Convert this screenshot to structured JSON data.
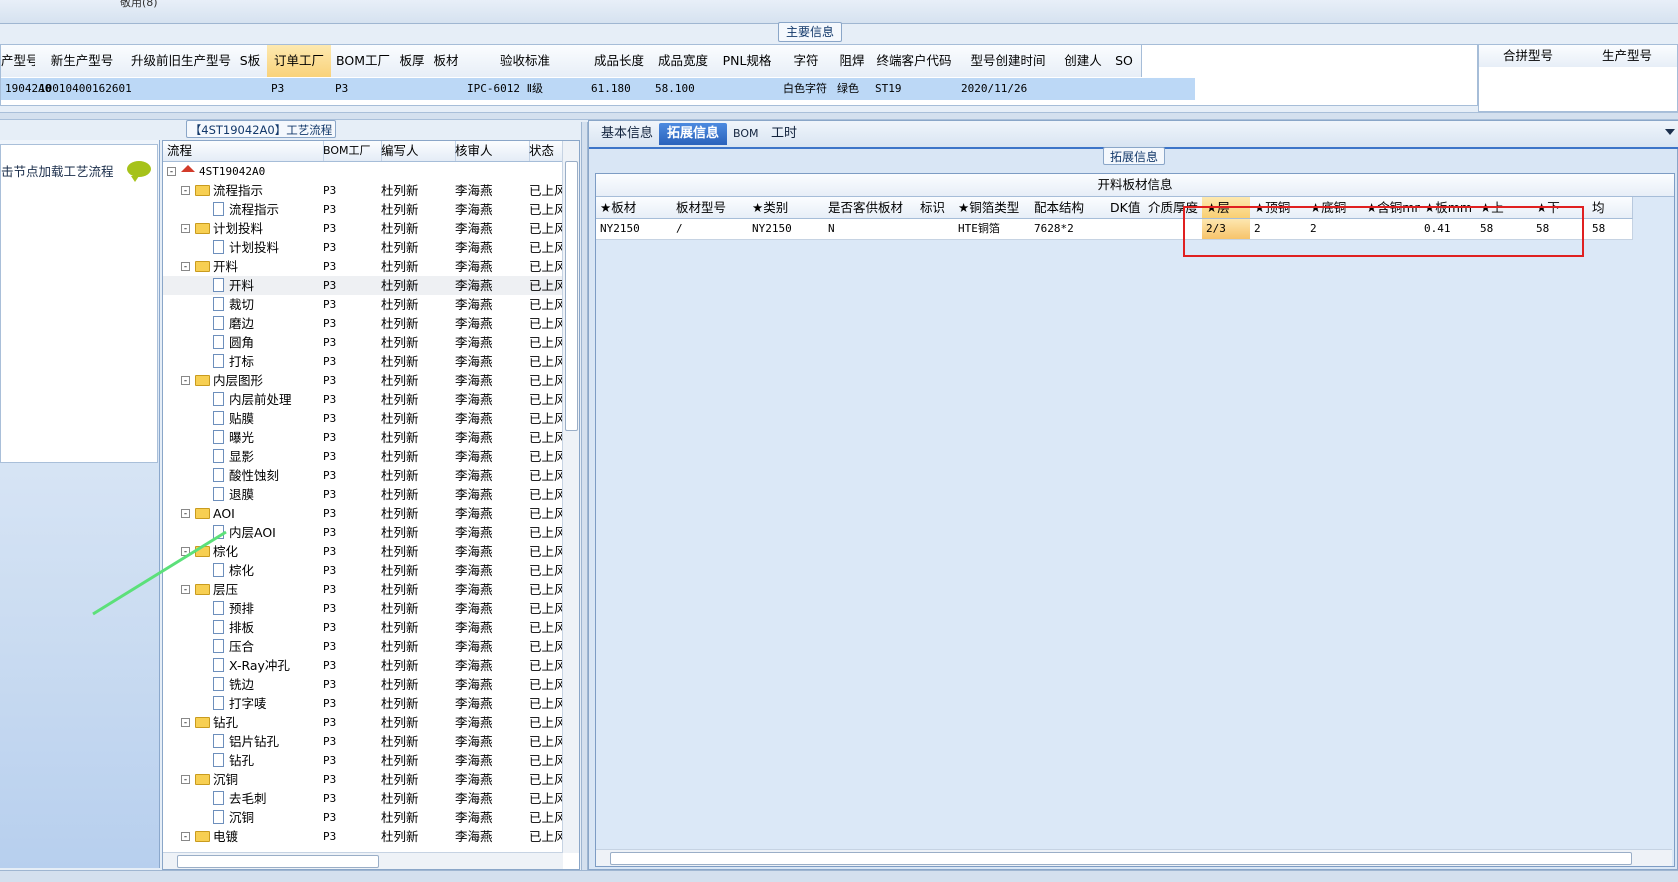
{
  "topbar": {
    "partial_text": "敬用(8)"
  },
  "main_info": {
    "title": "主要信息",
    "columns": [
      "产型号",
      "新生产型号",
      "升级前旧生产型号",
      "S板",
      "订单工厂",
      "BOM工厂",
      "板厚",
      "板材",
      "验收标准",
      "成品长度",
      "成品宽度",
      "PNL规格",
      "字符",
      "阻焊",
      "终端客户代码",
      "型号创建时间",
      "创建人",
      "SO"
    ],
    "row": [
      "19042A0",
      "10010400162601",
      "",
      "",
      "P3",
      "P3",
      "",
      "",
      "IPC-6012 Ⅱ级",
      "61.180",
      "58.100",
      "",
      "白色字符",
      "绿色",
      "ST19",
      "2020/11/26",
      "",
      ""
    ]
  },
  "right_info": {
    "columns": [
      "合拼型号",
      "生产型号"
    ]
  },
  "process": {
    "title": "【4ST19042A0】工艺流程",
    "hint": "击节点加载工艺流程",
    "columns": [
      "流程",
      "BOM工厂",
      "编写人",
      "核审人",
      "状态"
    ],
    "rows": [
      {
        "name": "4ST19042A0",
        "level": 0,
        "type": "root",
        "bom": "",
        "writer": "",
        "reviewer": "",
        "status": ""
      },
      {
        "name": "流程指示",
        "level": 1,
        "type": "folder",
        "bom": "P3",
        "writer": "杜列新",
        "reviewer": "李海燕",
        "status": "已上风"
      },
      {
        "name": "流程指示",
        "level": 2,
        "type": "doc",
        "bom": "P3",
        "writer": "杜列新",
        "reviewer": "李海燕",
        "status": "已上风"
      },
      {
        "name": "计划投料",
        "level": 1,
        "type": "folder",
        "bom": "P3",
        "writer": "杜列新",
        "reviewer": "李海燕",
        "status": "已上风"
      },
      {
        "name": "计划投料",
        "level": 2,
        "type": "doc",
        "bom": "P3",
        "writer": "杜列新",
        "reviewer": "李海燕",
        "status": "已上风"
      },
      {
        "name": "开料",
        "level": 1,
        "type": "folder",
        "bom": "P3",
        "writer": "杜列新",
        "reviewer": "李海燕",
        "status": "已上风"
      },
      {
        "name": "开料",
        "level": 2,
        "type": "doc",
        "bom": "P3",
        "writer": "杜列新",
        "reviewer": "李海燕",
        "status": "已上风",
        "selected": true
      },
      {
        "name": "裁切",
        "level": 2,
        "type": "doc",
        "bom": "P3",
        "writer": "杜列新",
        "reviewer": "李海燕",
        "status": "已上风"
      },
      {
        "name": "磨边",
        "level": 2,
        "type": "doc",
        "bom": "P3",
        "writer": "杜列新",
        "reviewer": "李海燕",
        "status": "已上风"
      },
      {
        "name": "圆角",
        "level": 2,
        "type": "doc",
        "bom": "P3",
        "writer": "杜列新",
        "reviewer": "李海燕",
        "status": "已上风"
      },
      {
        "name": "打标",
        "level": 2,
        "type": "doc",
        "bom": "P3",
        "writer": "杜列新",
        "reviewer": "李海燕",
        "status": "已上风"
      },
      {
        "name": "内层图形",
        "level": 1,
        "type": "folder",
        "bom": "P3",
        "writer": "杜列新",
        "reviewer": "李海燕",
        "status": "已上风"
      },
      {
        "name": "内层前处理",
        "level": 2,
        "type": "doc",
        "bom": "P3",
        "writer": "杜列新",
        "reviewer": "李海燕",
        "status": "已上风"
      },
      {
        "name": "贴膜",
        "level": 2,
        "type": "doc",
        "bom": "P3",
        "writer": "杜列新",
        "reviewer": "李海燕",
        "status": "已上风"
      },
      {
        "name": "曝光",
        "level": 2,
        "type": "doc",
        "bom": "P3",
        "writer": "杜列新",
        "reviewer": "李海燕",
        "status": "已上风"
      },
      {
        "name": "显影",
        "level": 2,
        "type": "doc",
        "bom": "P3",
        "writer": "杜列新",
        "reviewer": "李海燕",
        "status": "已上风"
      },
      {
        "name": "酸性蚀刻",
        "level": 2,
        "type": "doc",
        "bom": "P3",
        "writer": "杜列新",
        "reviewer": "李海燕",
        "status": "已上风"
      },
      {
        "name": "退膜",
        "level": 2,
        "type": "doc",
        "bom": "P3",
        "writer": "杜列新",
        "reviewer": "李海燕",
        "status": "已上风"
      },
      {
        "name": "AOI",
        "level": 1,
        "type": "folder",
        "bom": "P3",
        "writer": "杜列新",
        "reviewer": "李海燕",
        "status": "已上风"
      },
      {
        "name": "内层AOI",
        "level": 2,
        "type": "doc",
        "bom": "P3",
        "writer": "杜列新",
        "reviewer": "李海燕",
        "status": "已上风"
      },
      {
        "name": "棕化",
        "level": 1,
        "type": "folder",
        "bom": "P3",
        "writer": "杜列新",
        "reviewer": "李海燕",
        "status": "已上风"
      },
      {
        "name": "棕化",
        "level": 2,
        "type": "doc",
        "bom": "P3",
        "writer": "杜列新",
        "reviewer": "李海燕",
        "status": "已上风"
      },
      {
        "name": "层压",
        "level": 1,
        "type": "folder",
        "bom": "P3",
        "writer": "杜列新",
        "reviewer": "李海燕",
        "status": "已上风"
      },
      {
        "name": "预排",
        "level": 2,
        "type": "doc",
        "bom": "P3",
        "writer": "杜列新",
        "reviewer": "李海燕",
        "status": "已上风"
      },
      {
        "name": "排板",
        "level": 2,
        "type": "doc",
        "bom": "P3",
        "writer": "杜列新",
        "reviewer": "李海燕",
        "status": "已上风"
      },
      {
        "name": "压合",
        "level": 2,
        "type": "doc",
        "bom": "P3",
        "writer": "杜列新",
        "reviewer": "李海燕",
        "status": "已上风"
      },
      {
        "name": "X-Ray冲孔",
        "level": 2,
        "type": "doc",
        "bom": "P3",
        "writer": "杜列新",
        "reviewer": "李海燕",
        "status": "已上风"
      },
      {
        "name": "铣边",
        "level": 2,
        "type": "doc",
        "bom": "P3",
        "writer": "杜列新",
        "reviewer": "李海燕",
        "status": "已上风"
      },
      {
        "name": "打字唛",
        "level": 2,
        "type": "doc",
        "bom": "P3",
        "writer": "杜列新",
        "reviewer": "李海燕",
        "status": "已上风"
      },
      {
        "name": "钻孔",
        "level": 1,
        "type": "folder",
        "bom": "P3",
        "writer": "杜列新",
        "reviewer": "李海燕",
        "status": "已上风"
      },
      {
        "name": "铝片钻孔",
        "level": 2,
        "type": "doc",
        "bom": "P3",
        "writer": "杜列新",
        "reviewer": "李海燕",
        "status": "已上风"
      },
      {
        "name": "钻孔",
        "level": 2,
        "type": "doc",
        "bom": "P3",
        "writer": "杜列新",
        "reviewer": "李海燕",
        "status": "已上风"
      },
      {
        "name": "沉铜",
        "level": 1,
        "type": "folder",
        "bom": "P3",
        "writer": "杜列新",
        "reviewer": "李海燕",
        "status": "已上风"
      },
      {
        "name": "去毛刺",
        "level": 2,
        "type": "doc",
        "bom": "P3",
        "writer": "杜列新",
        "reviewer": "李海燕",
        "status": "已上风"
      },
      {
        "name": "沉铜",
        "level": 2,
        "type": "doc",
        "bom": "P3",
        "writer": "杜列新",
        "reviewer": "李海燕",
        "status": "已上风"
      },
      {
        "name": "电镀",
        "level": 1,
        "type": "folder",
        "bom": "P3",
        "writer": "杜列新",
        "reviewer": "李海燕",
        "status": "已上风"
      }
    ]
  },
  "tabs": [
    "基本信息",
    "拓展信息",
    "BOM",
    "工时"
  ],
  "active_tab": 1,
  "extension": {
    "group_title": "拓展信息",
    "table_title": "开料板材信息",
    "columns": [
      "★板材",
      "板材型号",
      "★类别",
      "是否客供板材",
      "标识",
      "★铜箔类型",
      "配本结构",
      "DK值",
      "介质厚度",
      "★层",
      "★顶铜",
      "★底铜",
      "★含铜mm",
      "★板mm",
      "★上",
      "★下",
      "均"
    ],
    "row": [
      "NY2150",
      "/",
      "NY2150",
      "N",
      "",
      "HTE铜箔",
      "7628*2",
      "",
      "",
      "2/3",
      "2",
      "2",
      "",
      "0.41",
      "58",
      "58",
      "58"
    ],
    "highlight_col": 9
  }
}
